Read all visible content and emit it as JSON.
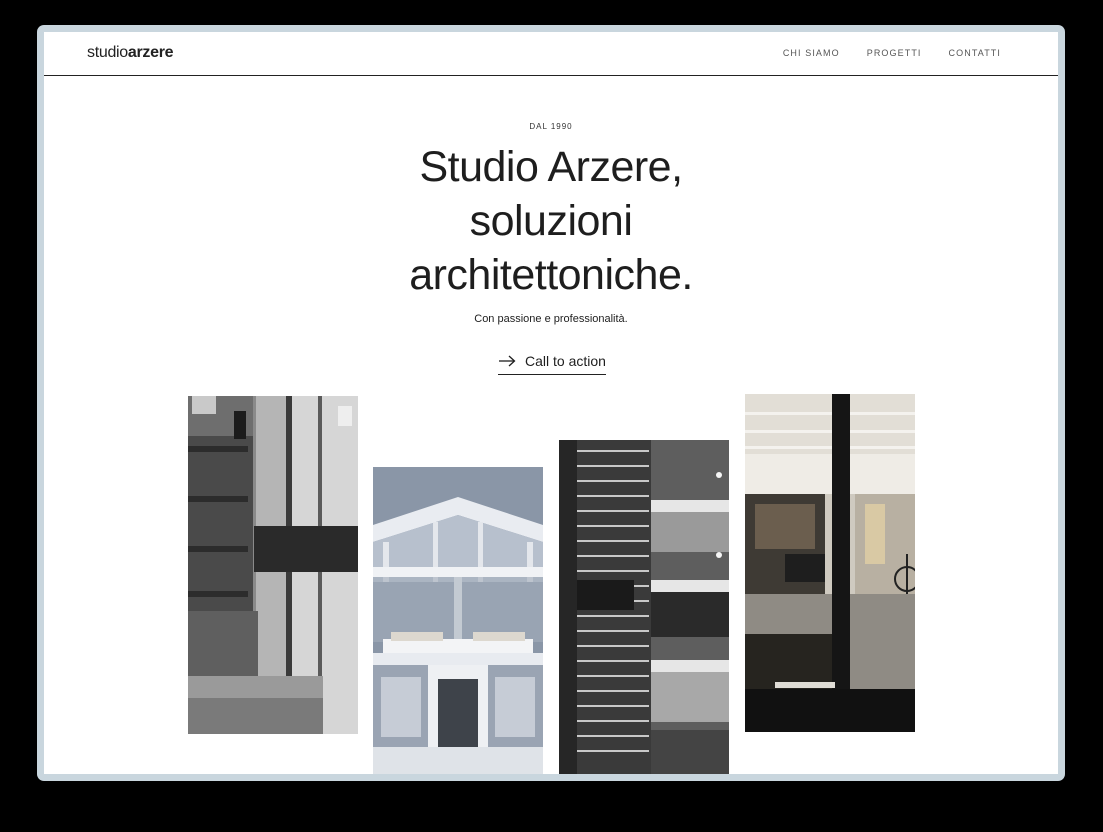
{
  "header": {
    "logo": {
      "light": "studio",
      "bold": "arzere"
    },
    "nav": [
      {
        "label": "CHI SIAMO"
      },
      {
        "label": "PROGETTI"
      },
      {
        "label": "CONTATTI"
      }
    ]
  },
  "hero": {
    "eyebrow": "DAL 1990",
    "headline_lines": [
      "Studio Arzere,",
      "soluzioni",
      "architettoniche."
    ],
    "subtitle": "Con passione e professionalità.",
    "cta_label": "Call to action",
    "cta_icon": "arrow-right-icon"
  },
  "gallery": {
    "images": [
      {
        "name": "photo-interior-staircase"
      },
      {
        "name": "photo-section-render"
      },
      {
        "name": "photo-facade-louvers"
      },
      {
        "name": "photo-open-space-bicycle"
      }
    ]
  },
  "colors": {
    "background": "#ffffff",
    "text": "#1e1e1e",
    "frame": "#c9d6de",
    "outer": "#000000"
  }
}
